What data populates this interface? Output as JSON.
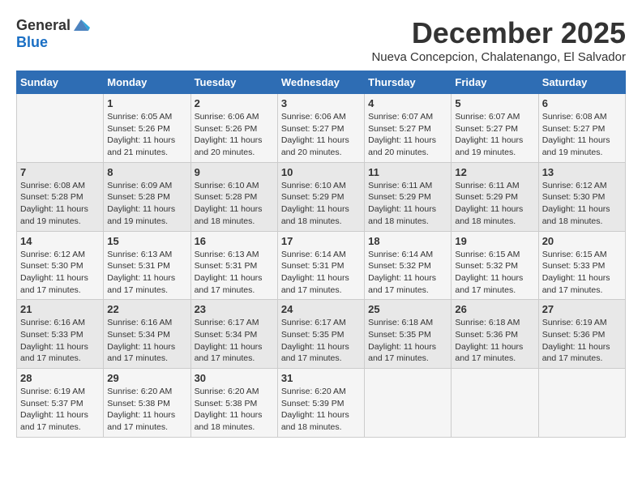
{
  "logo": {
    "general": "General",
    "blue": "Blue"
  },
  "title": {
    "month": "December 2025",
    "location": "Nueva Concepcion, Chalatenango, El Salvador"
  },
  "days_of_week": [
    "Sunday",
    "Monday",
    "Tuesday",
    "Wednesday",
    "Thursday",
    "Friday",
    "Saturday"
  ],
  "weeks": [
    [
      {
        "day": "",
        "sunrise": "",
        "sunset": "",
        "daylight": ""
      },
      {
        "day": "1",
        "sunrise": "Sunrise: 6:05 AM",
        "sunset": "Sunset: 5:26 PM",
        "daylight": "Daylight: 11 hours and 21 minutes."
      },
      {
        "day": "2",
        "sunrise": "Sunrise: 6:06 AM",
        "sunset": "Sunset: 5:26 PM",
        "daylight": "Daylight: 11 hours and 20 minutes."
      },
      {
        "day": "3",
        "sunrise": "Sunrise: 6:06 AM",
        "sunset": "Sunset: 5:27 PM",
        "daylight": "Daylight: 11 hours and 20 minutes."
      },
      {
        "day": "4",
        "sunrise": "Sunrise: 6:07 AM",
        "sunset": "Sunset: 5:27 PM",
        "daylight": "Daylight: 11 hours and 20 minutes."
      },
      {
        "day": "5",
        "sunrise": "Sunrise: 6:07 AM",
        "sunset": "Sunset: 5:27 PM",
        "daylight": "Daylight: 11 hours and 19 minutes."
      },
      {
        "day": "6",
        "sunrise": "Sunrise: 6:08 AM",
        "sunset": "Sunset: 5:27 PM",
        "daylight": "Daylight: 11 hours and 19 minutes."
      }
    ],
    [
      {
        "day": "7",
        "sunrise": "Sunrise: 6:08 AM",
        "sunset": "Sunset: 5:28 PM",
        "daylight": "Daylight: 11 hours and 19 minutes."
      },
      {
        "day": "8",
        "sunrise": "Sunrise: 6:09 AM",
        "sunset": "Sunset: 5:28 PM",
        "daylight": "Daylight: 11 hours and 19 minutes."
      },
      {
        "day": "9",
        "sunrise": "Sunrise: 6:10 AM",
        "sunset": "Sunset: 5:28 PM",
        "daylight": "Daylight: 11 hours and 18 minutes."
      },
      {
        "day": "10",
        "sunrise": "Sunrise: 6:10 AM",
        "sunset": "Sunset: 5:29 PM",
        "daylight": "Daylight: 11 hours and 18 minutes."
      },
      {
        "day": "11",
        "sunrise": "Sunrise: 6:11 AM",
        "sunset": "Sunset: 5:29 PM",
        "daylight": "Daylight: 11 hours and 18 minutes."
      },
      {
        "day": "12",
        "sunrise": "Sunrise: 6:11 AM",
        "sunset": "Sunset: 5:29 PM",
        "daylight": "Daylight: 11 hours and 18 minutes."
      },
      {
        "day": "13",
        "sunrise": "Sunrise: 6:12 AM",
        "sunset": "Sunset: 5:30 PM",
        "daylight": "Daylight: 11 hours and 18 minutes."
      }
    ],
    [
      {
        "day": "14",
        "sunrise": "Sunrise: 6:12 AM",
        "sunset": "Sunset: 5:30 PM",
        "daylight": "Daylight: 11 hours and 17 minutes."
      },
      {
        "day": "15",
        "sunrise": "Sunrise: 6:13 AM",
        "sunset": "Sunset: 5:31 PM",
        "daylight": "Daylight: 11 hours and 17 minutes."
      },
      {
        "day": "16",
        "sunrise": "Sunrise: 6:13 AM",
        "sunset": "Sunset: 5:31 PM",
        "daylight": "Daylight: 11 hours and 17 minutes."
      },
      {
        "day": "17",
        "sunrise": "Sunrise: 6:14 AM",
        "sunset": "Sunset: 5:31 PM",
        "daylight": "Daylight: 11 hours and 17 minutes."
      },
      {
        "day": "18",
        "sunrise": "Sunrise: 6:14 AM",
        "sunset": "Sunset: 5:32 PM",
        "daylight": "Daylight: 11 hours and 17 minutes."
      },
      {
        "day": "19",
        "sunrise": "Sunrise: 6:15 AM",
        "sunset": "Sunset: 5:32 PM",
        "daylight": "Daylight: 11 hours and 17 minutes."
      },
      {
        "day": "20",
        "sunrise": "Sunrise: 6:15 AM",
        "sunset": "Sunset: 5:33 PM",
        "daylight": "Daylight: 11 hours and 17 minutes."
      }
    ],
    [
      {
        "day": "21",
        "sunrise": "Sunrise: 6:16 AM",
        "sunset": "Sunset: 5:33 PM",
        "daylight": "Daylight: 11 hours and 17 minutes."
      },
      {
        "day": "22",
        "sunrise": "Sunrise: 6:16 AM",
        "sunset": "Sunset: 5:34 PM",
        "daylight": "Daylight: 11 hours and 17 minutes."
      },
      {
        "day": "23",
        "sunrise": "Sunrise: 6:17 AM",
        "sunset": "Sunset: 5:34 PM",
        "daylight": "Daylight: 11 hours and 17 minutes."
      },
      {
        "day": "24",
        "sunrise": "Sunrise: 6:17 AM",
        "sunset": "Sunset: 5:35 PM",
        "daylight": "Daylight: 11 hours and 17 minutes."
      },
      {
        "day": "25",
        "sunrise": "Sunrise: 6:18 AM",
        "sunset": "Sunset: 5:35 PM",
        "daylight": "Daylight: 11 hours and 17 minutes."
      },
      {
        "day": "26",
        "sunrise": "Sunrise: 6:18 AM",
        "sunset": "Sunset: 5:36 PM",
        "daylight": "Daylight: 11 hours and 17 minutes."
      },
      {
        "day": "27",
        "sunrise": "Sunrise: 6:19 AM",
        "sunset": "Sunset: 5:36 PM",
        "daylight": "Daylight: 11 hours and 17 minutes."
      }
    ],
    [
      {
        "day": "28",
        "sunrise": "Sunrise: 6:19 AM",
        "sunset": "Sunset: 5:37 PM",
        "daylight": "Daylight: 11 hours and 17 minutes."
      },
      {
        "day": "29",
        "sunrise": "Sunrise: 6:20 AM",
        "sunset": "Sunset: 5:38 PM",
        "daylight": "Daylight: 11 hours and 17 minutes."
      },
      {
        "day": "30",
        "sunrise": "Sunrise: 6:20 AM",
        "sunset": "Sunset: 5:38 PM",
        "daylight": "Daylight: 11 hours and 18 minutes."
      },
      {
        "day": "31",
        "sunrise": "Sunrise: 6:20 AM",
        "sunset": "Sunset: 5:39 PM",
        "daylight": "Daylight: 11 hours and 18 minutes."
      },
      {
        "day": "",
        "sunrise": "",
        "sunset": "",
        "daylight": ""
      },
      {
        "day": "",
        "sunrise": "",
        "sunset": "",
        "daylight": ""
      },
      {
        "day": "",
        "sunrise": "",
        "sunset": "",
        "daylight": ""
      }
    ]
  ]
}
